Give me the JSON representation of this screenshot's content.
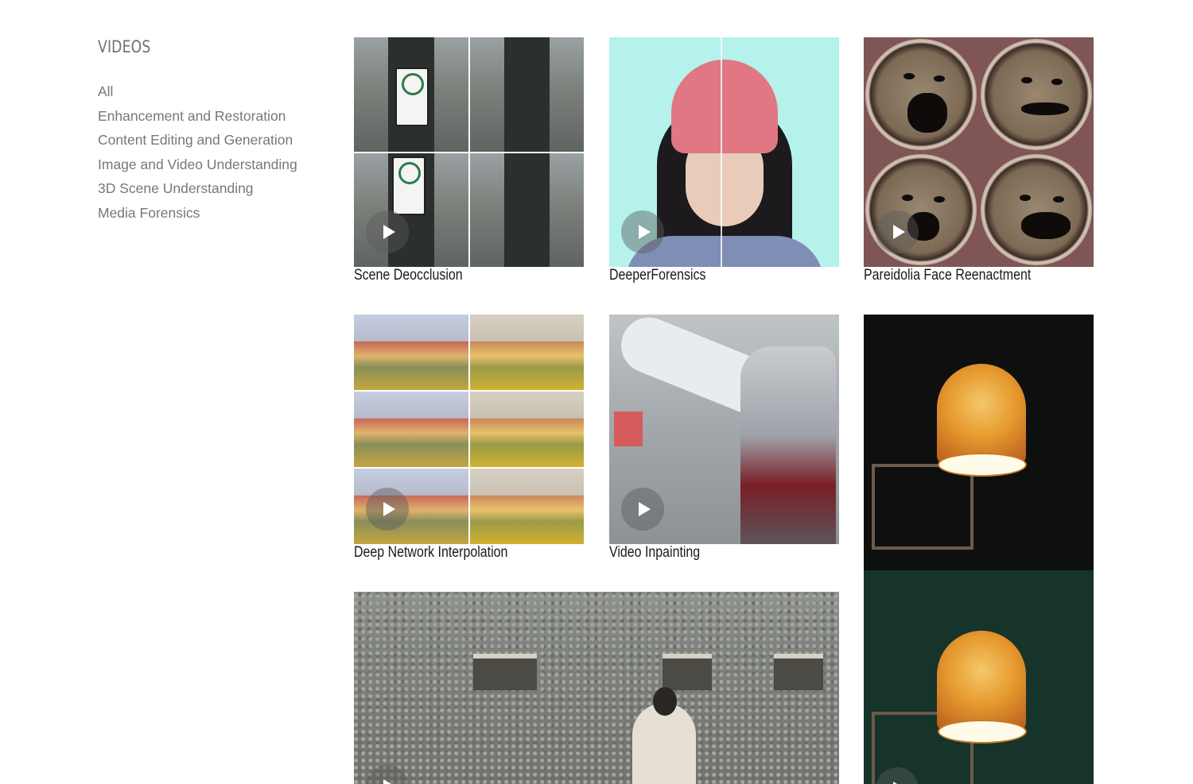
{
  "sidebar": {
    "title": "VIDEOS",
    "filters": [
      "All",
      "Enhancement and Restoration",
      "Content Editing and Generation",
      "Image and Video Understanding",
      "3D Scene Understanding",
      "Media Forensics"
    ]
  },
  "videos": [
    {
      "caption": "Scene Deocclusion",
      "icon": "play-icon"
    },
    {
      "caption": "DeeperForensics",
      "icon": "play-icon"
    },
    {
      "caption": "Pareidolia Face Reenactment",
      "icon": "play-icon"
    },
    {
      "caption": "Deep Network Interpolation",
      "icon": "play-icon"
    },
    {
      "caption": "Video Inpainting",
      "icon": "play-icon"
    },
    {
      "caption": "",
      "icon": "play-icon"
    },
    {
      "caption": "",
      "icon": "play-icon"
    }
  ],
  "colors": {
    "sidebar_text": "#74787e",
    "caption_text": "#1a1a1a",
    "background": "#ffffff"
  }
}
